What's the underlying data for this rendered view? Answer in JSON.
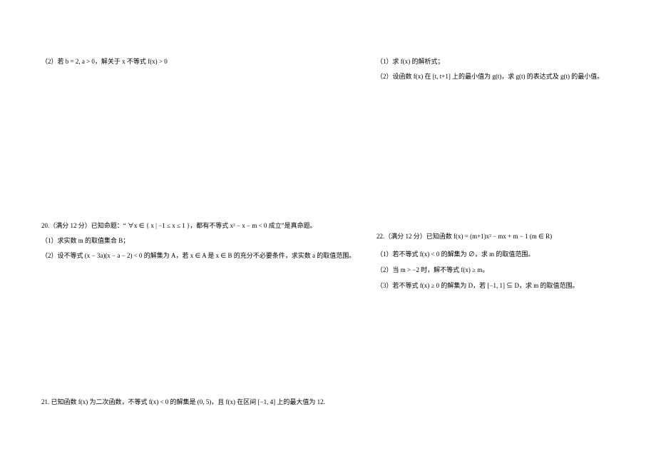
{
  "left": {
    "q19_2": "（2）若 b = 2, a > 0，解关于 x 不等式 f(x) > 0",
    "q20_h": "20.（满分 12 分）已知命题：“ ∀x ∈ { x | −1 ≤ x ≤ 1 }，都有不等式 x² − x − m < 0 成立”是真命题。",
    "q20_1": "（1）求实数 m 的取值集合 B；",
    "q20_2": "（2）设不等式 (x − 3a)(x − a − 2) < 0 的解集为 A，若 x ∈ A 是 x ∈ B 的充分不必要条件，求实数 a 的取值范围。",
    "q21_h": "21. 已知函数 f(x) 为二次函数，不等式 f(x) < 0 的解集是 (0, 5)，且 f(x) 在区间 [−1, 4] 上的最大值为 12."
  },
  "right": {
    "q21_1": "（1）求 f(x) 的解析式；",
    "q21_2": "（2）设函数 f(x) 在 [t, t+1] 上的最小值为 g(t)，求 g(t) 的表达式及 g(t) 的最小值。",
    "q22_h": "22.（满分 12 分）已知函数 f(x) = (m+1)x² − mx + m − 1 (m ∈ R)",
    "q22_1": "（1）若不等式 f(x) < 0 的解集为 ∅，求 m 的取值范围。",
    "q22_2": "（2）当 m > −2 时，解不等式 f(x) ≥ m。",
    "q22_3": "（3）若不等式 f(x) ≥ 0 的解集为 D，若 [−1, 1] ⊆ D，求 m 的取值范围。"
  }
}
